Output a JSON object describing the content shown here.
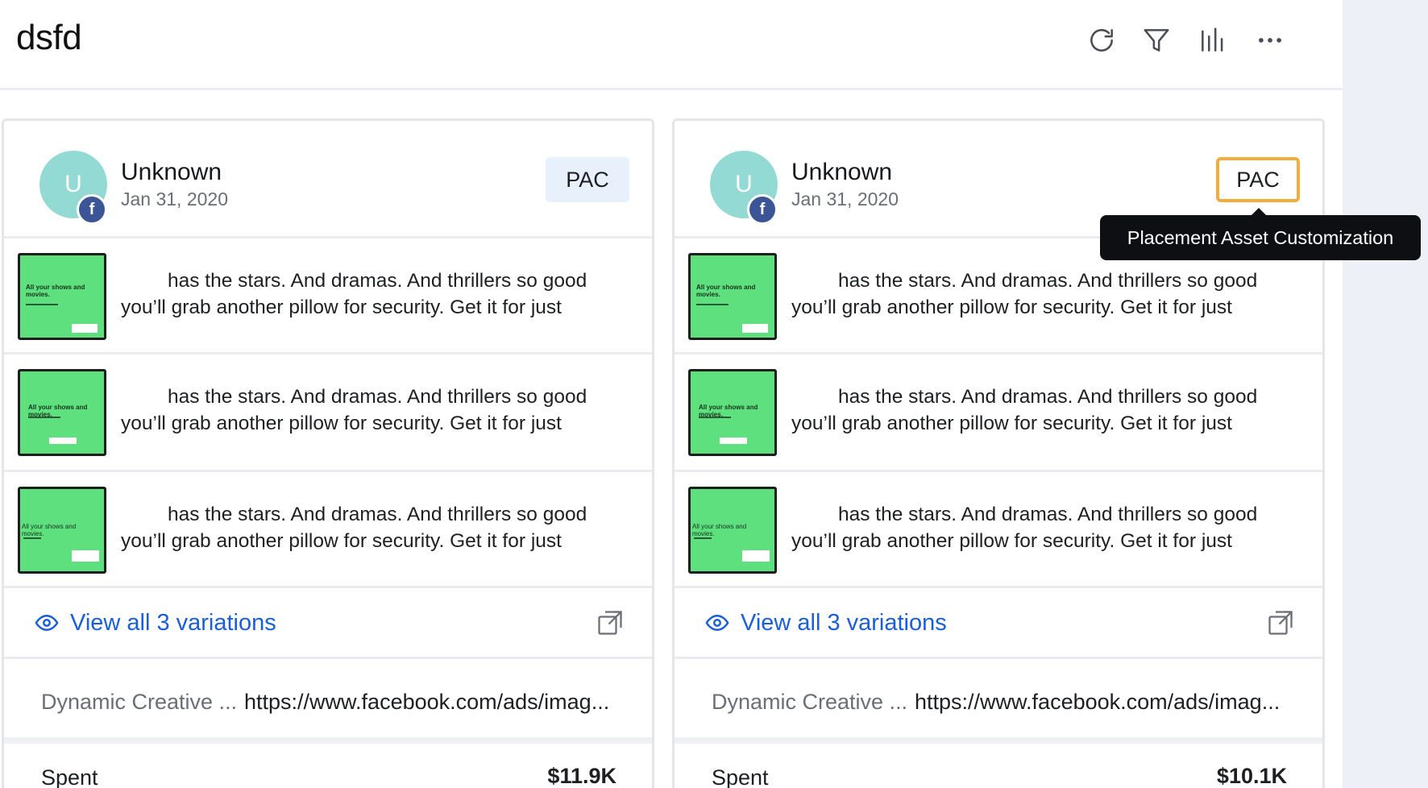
{
  "page": {
    "title": "dsfd"
  },
  "toolbar": {
    "refresh_icon": "refresh-icon",
    "filter_icon": "filter-icon",
    "columns_icon": "bar-chart-icon",
    "more_icon": "more-horizontal-icon"
  },
  "colors": {
    "accent_link": "#1a5ed8",
    "pac_focus_border": "#f3ad3c",
    "thumb_green": "#5fe07e",
    "avatar_teal": "#93d9d4",
    "facebook_blue": "#3b5597"
  },
  "cards": [
    {
      "avatar_initial": "U",
      "network_icon": "facebook-icon",
      "network_glyph": "f",
      "author": "Unknown",
      "date": "Jan 31, 2020",
      "badge": "PAC",
      "variations": [
        {
          "thumb_text": "All your shows and movies.",
          "text": "has the stars. And dramas. And thrillers so good you’ll grab another pillow for security. Get it for just"
        },
        {
          "thumb_text": "All your shows and movies.",
          "text": "has the stars. And dramas. And thrillers so good you’ll grab another pillow for security. Get it for just"
        },
        {
          "thumb_text": "All your shows and movies.",
          "text": "has the stars. And dramas. And thrillers so good you’ll grab another pillow for security. Get it for just"
        }
      ],
      "view_all_label": "View all 3 variations",
      "meta_label": "Dynamic Creative ...",
      "meta_url": "https://www.facebook.com/ads/imag...",
      "spent_label": "Spent",
      "spent_value": "$11.9K"
    },
    {
      "avatar_initial": "U",
      "network_icon": "facebook-icon",
      "network_glyph": "f",
      "author": "Unknown",
      "date": "Jan 31, 2020",
      "badge": "PAC",
      "variations": [
        {
          "thumb_text": "All your shows and movies.",
          "text": "has the stars. And dramas. And thrillers so good you’ll grab another pillow for security. Get it for just"
        },
        {
          "thumb_text": "All your shows and movies.",
          "text": "has the stars. And dramas. And thrillers so good you’ll grab another pillow for security. Get it for just"
        },
        {
          "thumb_text": "All your shows and movies.",
          "text": "has the stars. And dramas. And thrillers so good you’ll grab another pillow for security. Get it for just"
        }
      ],
      "view_all_label": "View all 3 variations",
      "meta_label": "Dynamic Creative ...",
      "meta_url": "https://www.facebook.com/ads/imag...",
      "spent_label": "Spent",
      "spent_value": "$10.1K"
    }
  ],
  "tooltip": {
    "text": "Placement Asset Customization"
  }
}
